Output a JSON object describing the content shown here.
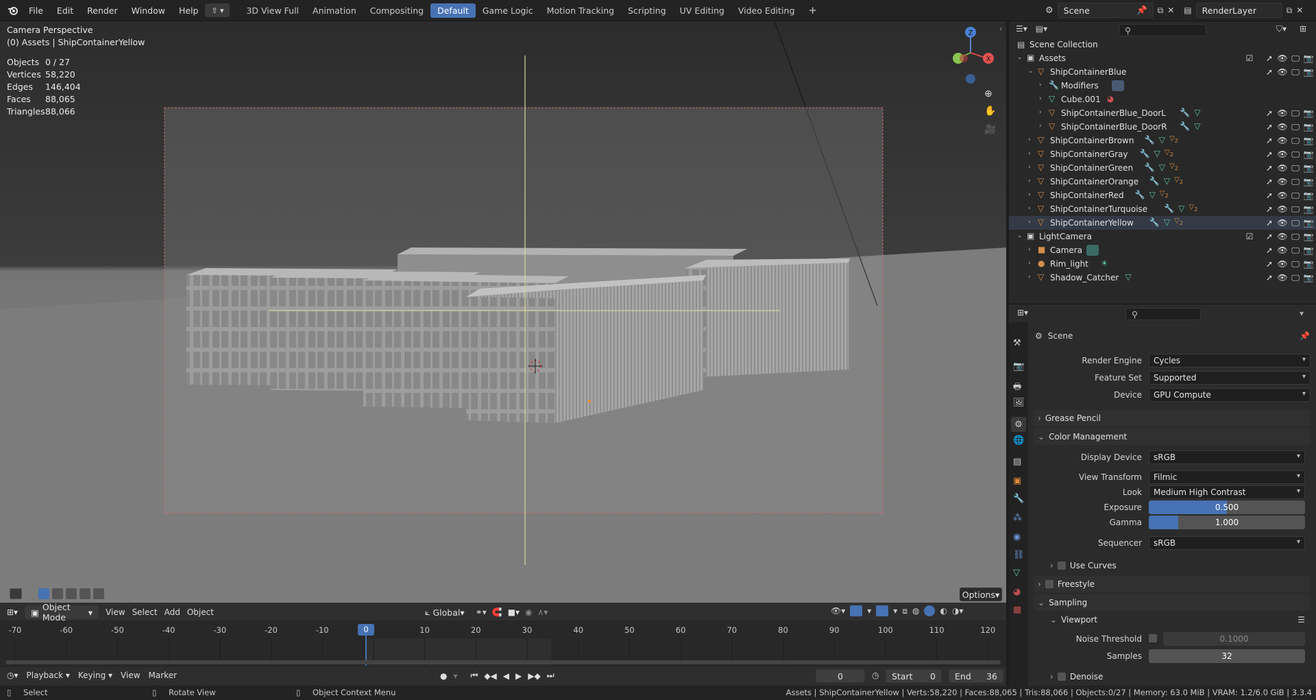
{
  "topbar": {
    "menus": [
      "File",
      "Edit",
      "Render",
      "Window",
      "Help"
    ],
    "workspaces": [
      "3D View Full",
      "Animation",
      "Compositing",
      "Default",
      "Game Logic",
      "Motion Tracking",
      "Scripting",
      "UV Editing",
      "Video Editing"
    ],
    "active_workspace": "Default",
    "scene_name": "Scene",
    "view_layer": "RenderLayer"
  },
  "viewport": {
    "view_name": "Camera Perspective",
    "context": "(0) Assets | ShipContainerYellow",
    "stats": [
      {
        "label": "Objects",
        "value": "0 / 27"
      },
      {
        "label": "Vertices",
        "value": "58,220"
      },
      {
        "label": "Edges",
        "value": "146,404"
      },
      {
        "label": "Faces",
        "value": "88,065"
      },
      {
        "label": "Triangles",
        "value": "88,066"
      }
    ],
    "options_label": "Options",
    "gizmo_axis_z": "Z",
    "gizmo_axis_x": "X"
  },
  "viewport_header": {
    "mode": "Object Mode",
    "menus": [
      "View",
      "Select",
      "Add",
      "Object"
    ],
    "orientation": "Global"
  },
  "timeline": {
    "ticks": [
      "-70",
      "-60",
      "-50",
      "-40",
      "-30",
      "-20",
      "-10",
      "0",
      "10",
      "20",
      "30",
      "40",
      "50",
      "60",
      "70",
      "80",
      "90",
      "100",
      "110",
      "120"
    ],
    "current_frame_marker": "0",
    "menus": [
      "Playback",
      "Keying",
      "View",
      "Marker"
    ],
    "current_frame": "0",
    "start_label": "Start",
    "start": "0",
    "end_label": "End",
    "end": "36"
  },
  "outliner": {
    "root": "Scene Collection",
    "items": [
      {
        "label": "Assets"
      },
      {
        "label": "ShipContainerBlue"
      },
      {
        "label": "Modifiers"
      },
      {
        "label": "Cube.001"
      },
      {
        "label": "ShipContainerBlue_DoorL"
      },
      {
        "label": "ShipContainerBlue_DoorR"
      },
      {
        "label": "ShipContainerBrown"
      },
      {
        "label": "ShipContainerGray"
      },
      {
        "label": "ShipContainerGreen"
      },
      {
        "label": "ShipContainerOrange"
      },
      {
        "label": "ShipContainerRed"
      },
      {
        "label": "ShipContainerTurquoise"
      },
      {
        "label": "ShipContainerYellow"
      },
      {
        "label": "LightCamera"
      },
      {
        "label": "Camera"
      },
      {
        "label": "Rim_light"
      },
      {
        "label": "Shadow_Catcher"
      }
    ],
    "mesh_badge": "2"
  },
  "properties": {
    "context": "Scene",
    "render_engine_label": "Render Engine",
    "render_engine": "Cycles",
    "feature_set_label": "Feature Set",
    "feature_set": "Supported",
    "device_label": "Device",
    "device": "GPU Compute",
    "grease_pencil": "Grease Pencil",
    "color_management": "Color Management",
    "display_device_label": "Display Device",
    "display_device": "sRGB",
    "view_transform_label": "View Transform",
    "view_transform": "Filmic",
    "look_label": "Look",
    "look": "Medium High Contrast",
    "exposure_label": "Exposure",
    "exposure": "0.500",
    "exposure_fraction": 0.5,
    "gamma_label": "Gamma",
    "gamma": "1.000",
    "gamma_fraction": 0.19,
    "sequencer_label": "Sequencer",
    "sequencer": "sRGB",
    "use_curves": "Use Curves",
    "freestyle": "Freestyle",
    "sampling": "Sampling",
    "viewport_sub": "Viewport",
    "noise_threshold_label": "Noise Threshold",
    "noise_threshold": "0.1000",
    "samples_label": "Samples",
    "samples": "32",
    "denoise": "Denoise"
  },
  "statusbar": {
    "select": "Select",
    "rotate": "Rotate View",
    "context_menu": "Object Context Menu",
    "info": "Assets | ShipContainerYellow | Verts:58,220 | Faces:88,065 | Tris:88,066 | Objects:0/27 | Memory: 63.0 MiB | VRAM: 1.2/6.0 GiB | 3.3.4"
  },
  "colors": {
    "accent": "#4772b3",
    "mesh_icon": "#d38e4a",
    "data_icon": "#5ec8a0",
    "wrench_icon": "#6b94d6"
  }
}
